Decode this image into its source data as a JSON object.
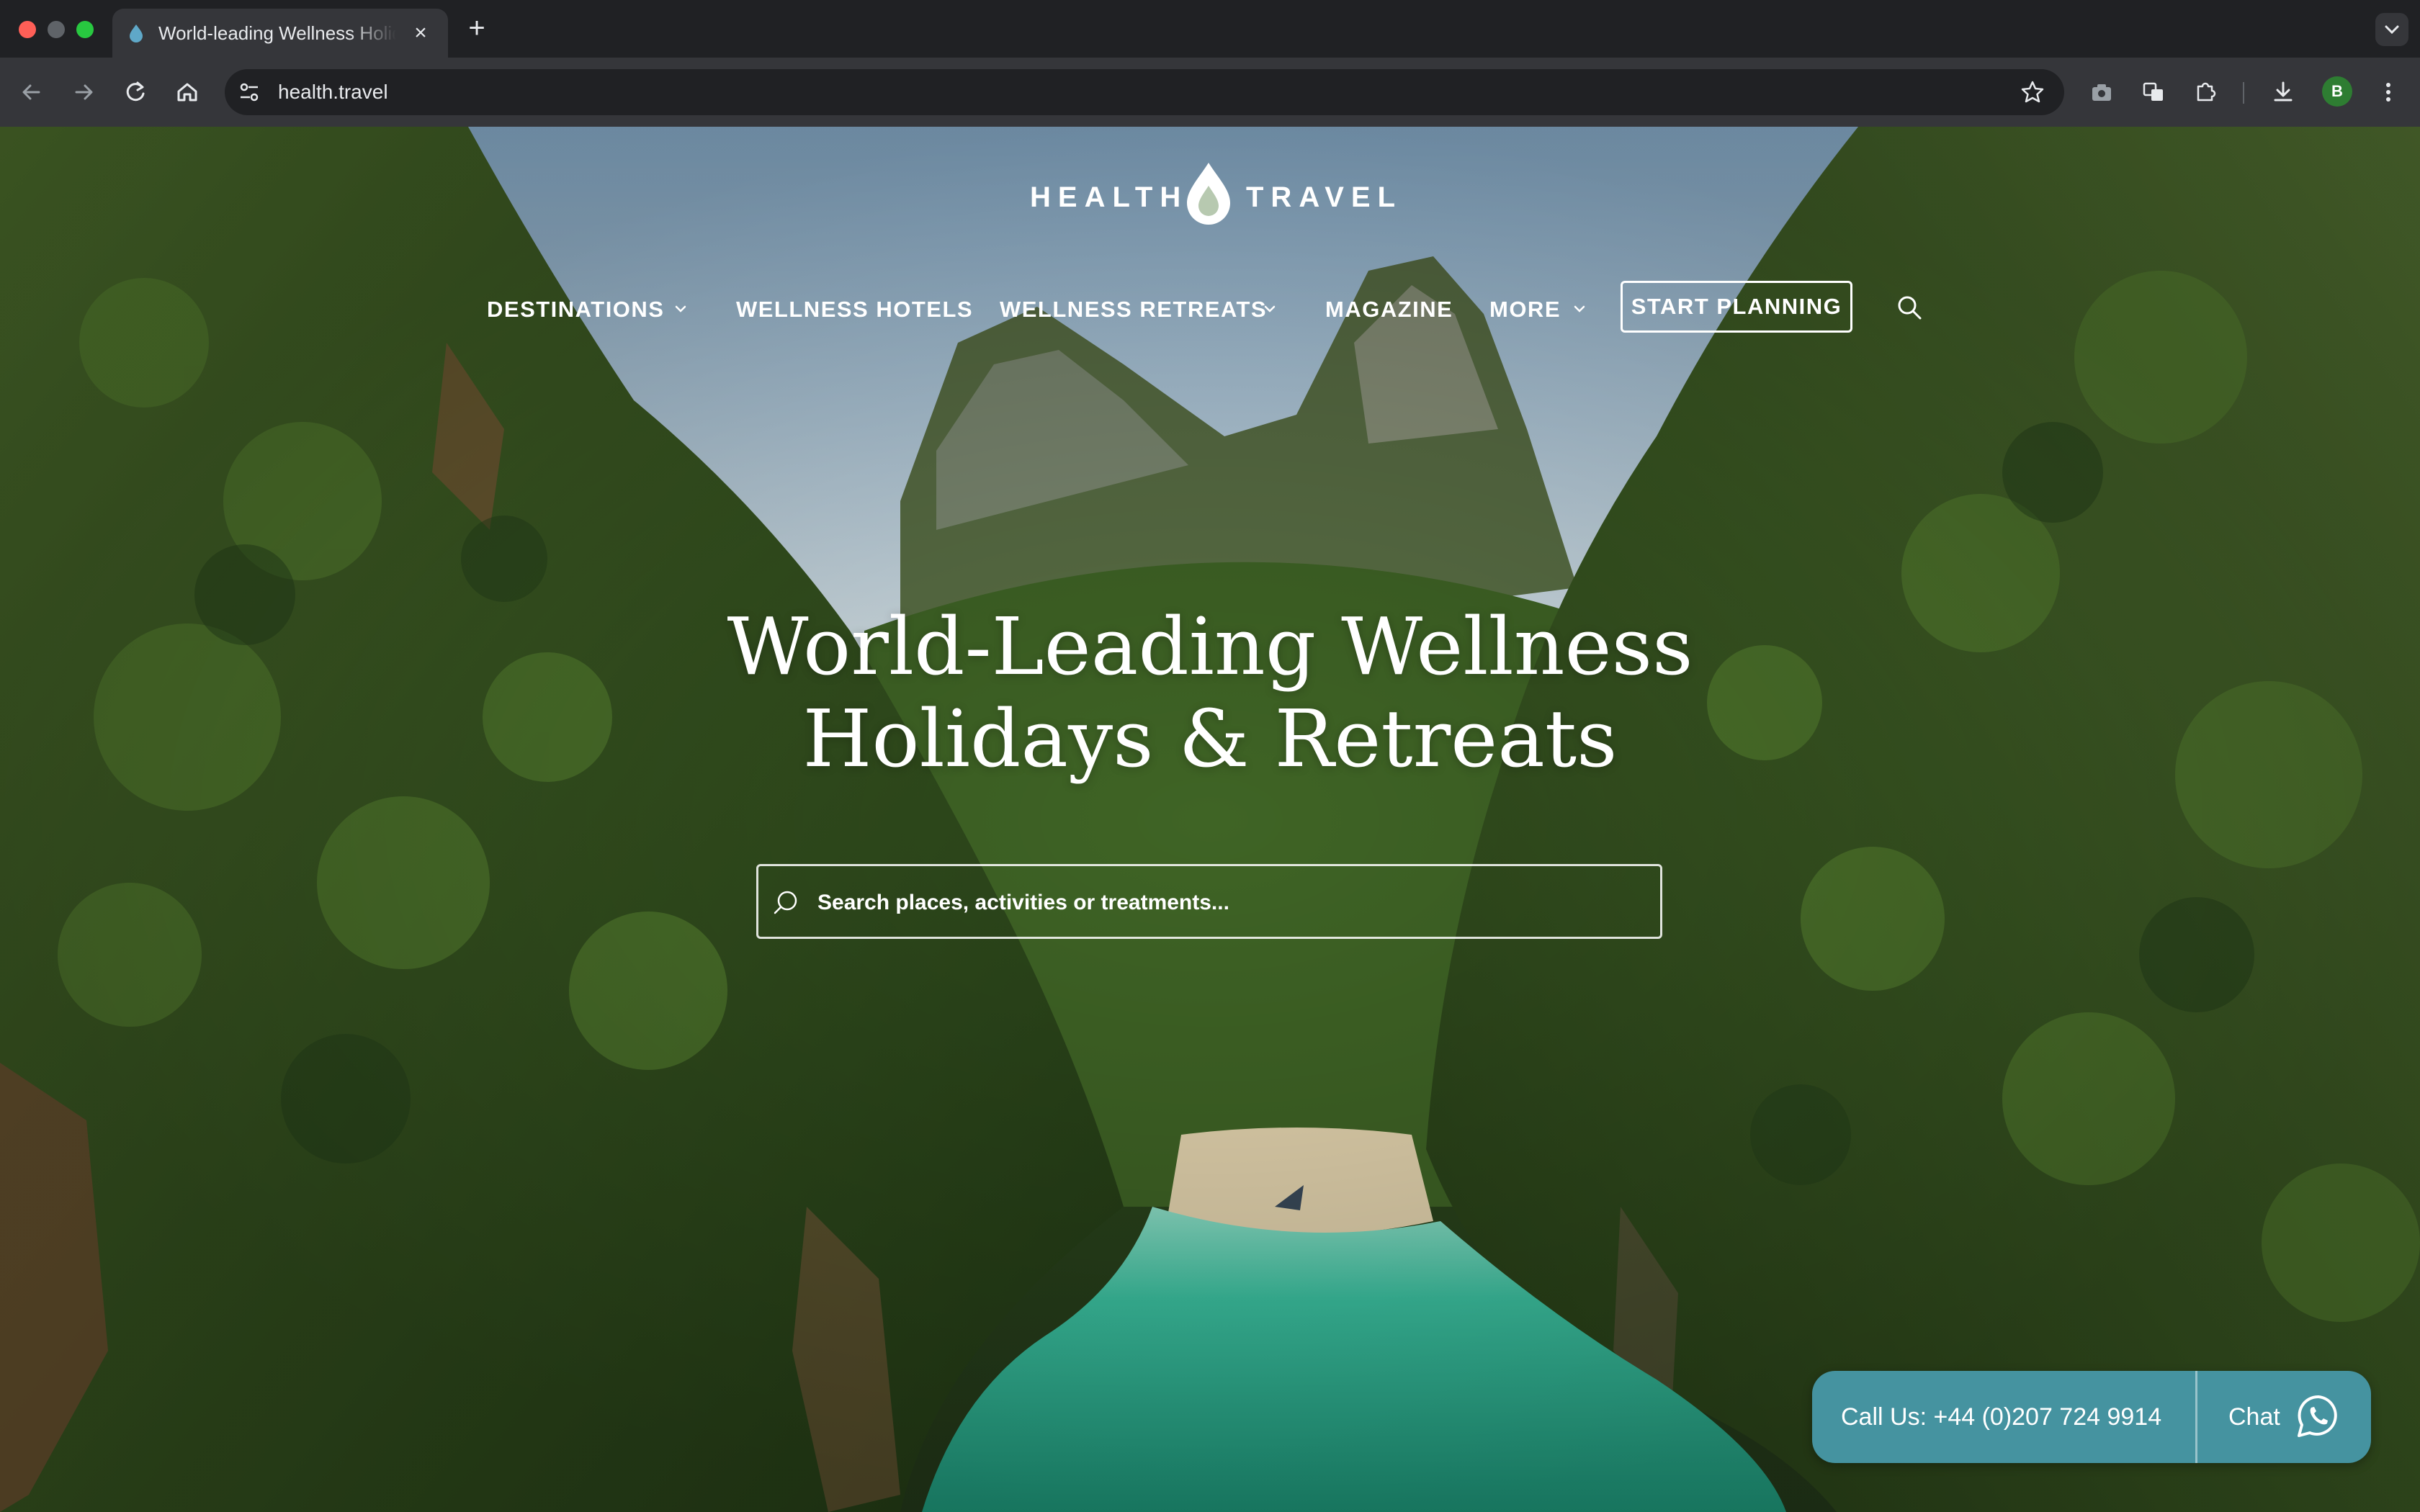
{
  "browser": {
    "tab_title": "World-leading Wellness Holidays & Retreats",
    "tab_close": "×",
    "new_tab": "+",
    "url": "health.travel",
    "profile_initial": "B"
  },
  "site": {
    "logo_left": "HEALTH",
    "logo_right": "TRAVEL",
    "nav": {
      "destinations": "DESTINATIONS",
      "wellness_hotels": "WELLNESS HOTELS",
      "wellness_retreats": "WELLNESS RETREATS",
      "magazine": "MAGAZINE",
      "more": "MORE",
      "cta": "START PLANNING"
    },
    "headline_line1": "World-Leading Wellness",
    "headline_line2": "Holidays & Retreats",
    "search_placeholder": "Search places, activities or treatments...",
    "call_label": "Call Us: +44 (0)207 724 9914",
    "chat_label": "Chat",
    "accent_color": "#4593a0"
  },
  "icons": [
    "drop-favicon-icon",
    "back-icon",
    "forward-icon",
    "reload-icon",
    "home-icon",
    "site-settings-icon",
    "star-icon",
    "camera-icon",
    "translate-icon",
    "extensions-icon",
    "download-icon",
    "kebab-menu-icon",
    "chevron-down-icon",
    "search-icon",
    "whatsapp-icon"
  ]
}
